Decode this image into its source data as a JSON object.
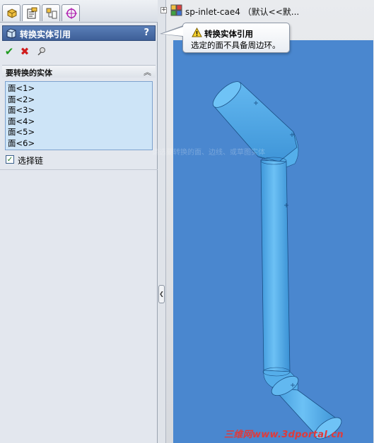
{
  "tabs": [
    {
      "icon": "feature-manager-icon"
    },
    {
      "icon": "property-manager-icon"
    },
    {
      "icon": "configuration-manager-icon"
    },
    {
      "icon": "dimxpert-manager-icon"
    }
  ],
  "panel": {
    "title": "转换实体引用",
    "help": "?",
    "group_title": "要转换的实体",
    "faces": [
      "面<1>",
      "面<2>",
      "面<3>",
      "面<4>",
      "面<5>",
      "面<6>"
    ],
    "chain_label": "选择链",
    "chain_checked": true
  },
  "tree": {
    "expander": "+",
    "label": "sp-inlet-cae4 （默认<<默..."
  },
  "tooltip": {
    "title": "转换实体引用",
    "body": "选定的面不具备周边环。"
  },
  "viewport": {
    "faded_hint": "请选要转换的面、边线、或草图实体",
    "watermark": "三维网www.3dportal.cn"
  },
  "colors": {
    "viewport_bg": "#4a87cf",
    "pipe": "#5ab0ec",
    "title_bar": "#3e5f98",
    "list_bg": "#cde4f7"
  }
}
